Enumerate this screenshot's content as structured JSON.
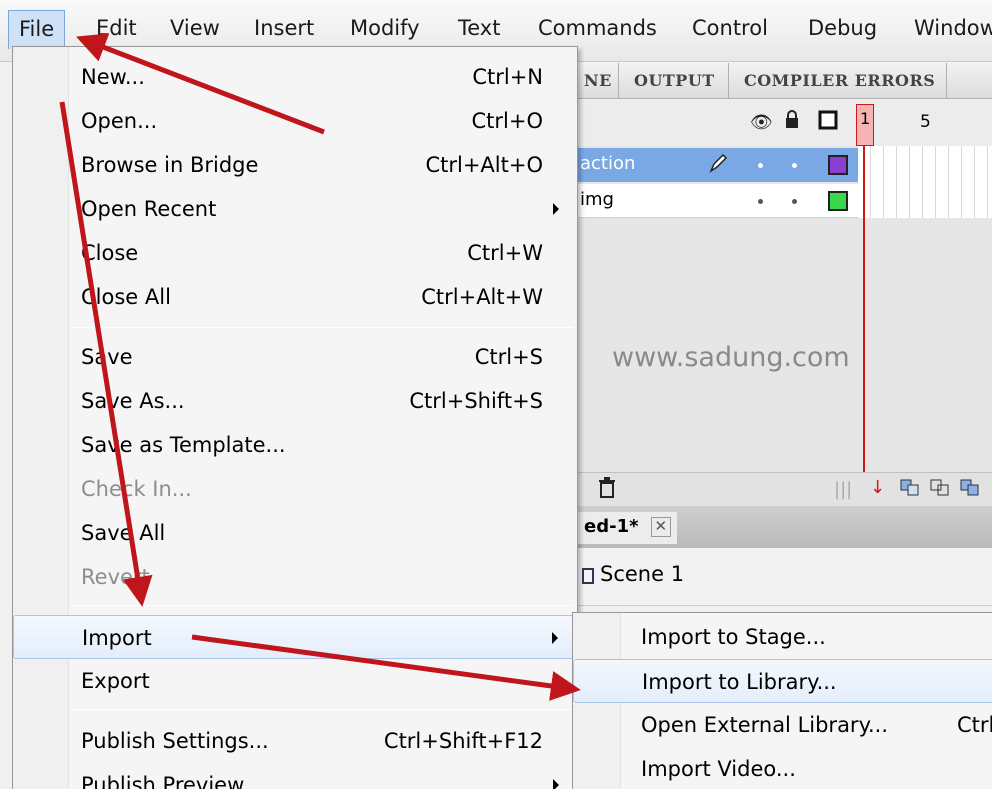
{
  "menubar": {
    "items": [
      "File",
      "Edit",
      "View",
      "Insert",
      "Modify",
      "Text",
      "Commands",
      "Control",
      "Debug",
      "Window"
    ]
  },
  "panel": {
    "tabs": [
      "NE",
      "OUTPUT",
      "COMPILER ERRORS"
    ],
    "layers": [
      "action",
      "img"
    ],
    "frame_current": "1",
    "frame_label": "5",
    "watermark": "www.sadung.com"
  },
  "document": {
    "tab_label": "ed-1*",
    "close_glyph": "✕",
    "scene_label": "Scene 1"
  },
  "file_menu": {
    "items": [
      {
        "label": "New...",
        "shortcut": "Ctrl+N"
      },
      {
        "label": "Open...",
        "shortcut": "Ctrl+O"
      },
      {
        "label": "Browse in Bridge",
        "shortcut": "Ctrl+Alt+O"
      },
      {
        "label": "Open Recent",
        "shortcut": ""
      },
      {
        "label": "Close",
        "shortcut": "Ctrl+W"
      },
      {
        "label": "Close All",
        "shortcut": "Ctrl+Alt+W"
      },
      {
        "label": "Save",
        "shortcut": "Ctrl+S"
      },
      {
        "label": "Save As...",
        "shortcut": "Ctrl+Shift+S"
      },
      {
        "label": "Save as Template...",
        "shortcut": ""
      },
      {
        "label": "Check In...",
        "shortcut": ""
      },
      {
        "label": "Save All",
        "shortcut": ""
      },
      {
        "label": "Revert",
        "shortcut": ""
      },
      {
        "label": "Import",
        "shortcut": ""
      },
      {
        "label": "Export",
        "shortcut": ""
      },
      {
        "label": "Publish Settings...",
        "shortcut": "Ctrl+Shift+F12"
      },
      {
        "label": "Publish Preview",
        "shortcut": ""
      }
    ]
  },
  "import_submenu": {
    "items": [
      {
        "label": "Import to Stage...",
        "shortcut": ""
      },
      {
        "label": "Import to Library...",
        "shortcut": ""
      },
      {
        "label": "Open External Library...",
        "shortcut": "Ctrl"
      },
      {
        "label": "Import Video...",
        "shortcut": ""
      }
    ]
  },
  "colors": {
    "annotation_arrow": "#c0151b",
    "selection_blue": "#7aa8e4",
    "layer_action": "#8a3fd0",
    "layer_img": "#3ad84a"
  }
}
